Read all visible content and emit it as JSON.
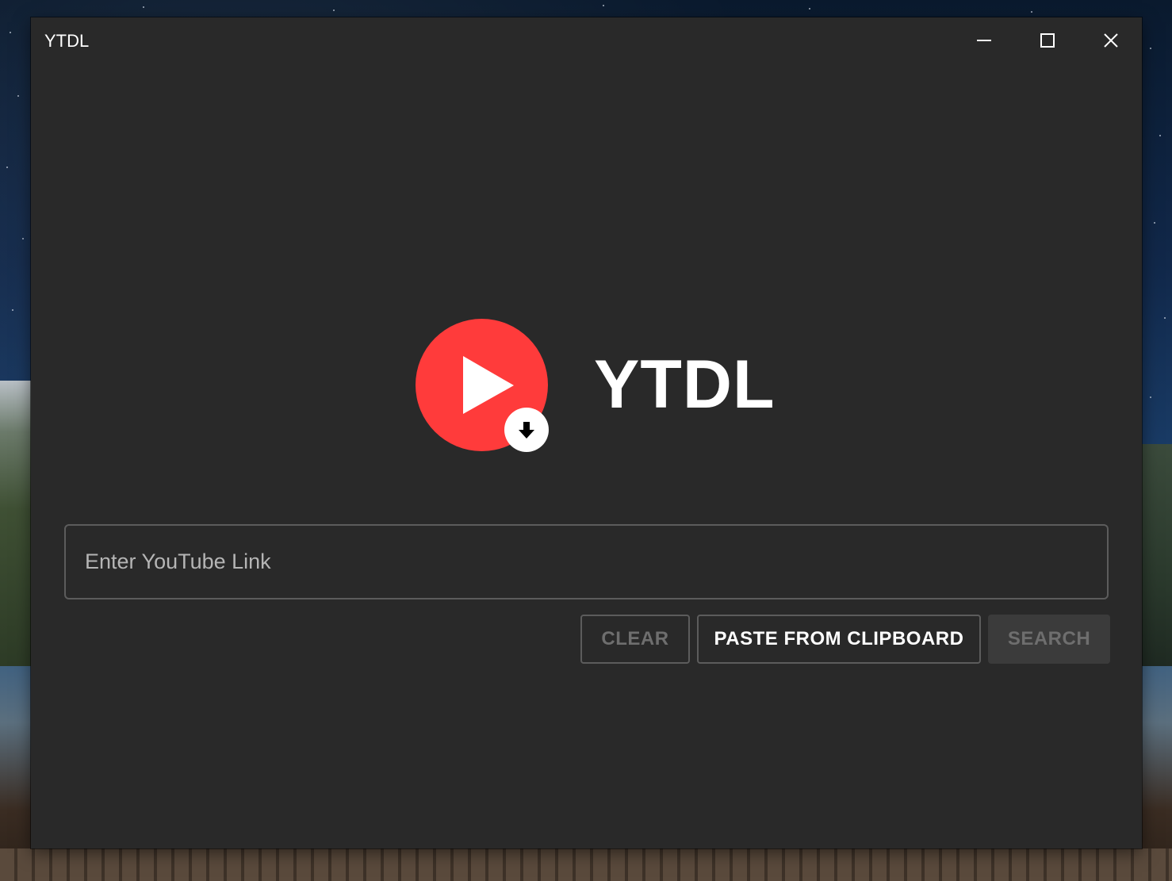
{
  "window": {
    "title": "YTDL"
  },
  "window_controls": {
    "minimize": "minimize-icon",
    "maximize": "maximize-icon",
    "close": "close-icon"
  },
  "logo": {
    "icon": "play-download-icon",
    "text": "YTDL",
    "colors": {
      "circle": "#ff3b3b",
      "badge": "#ffffff"
    }
  },
  "input": {
    "placeholder": "Enter YouTube Link",
    "value": ""
  },
  "buttons": {
    "clear": "CLEAR",
    "paste": "PASTE FROM CLIPBOARD",
    "search": "SEARCH"
  },
  "theme": {
    "background": "#292929",
    "border": "#5c5c5c",
    "disabled_text": "#6e6e6e"
  }
}
